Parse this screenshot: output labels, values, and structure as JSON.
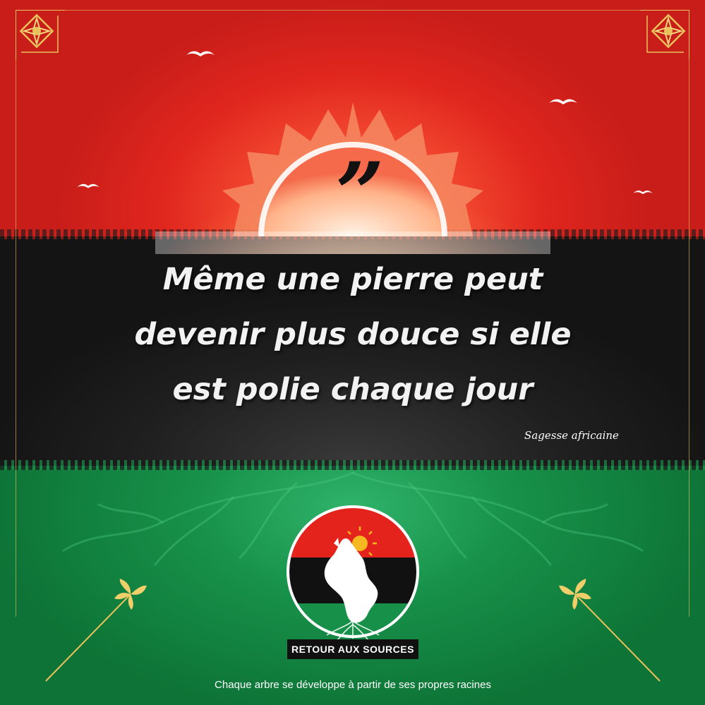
{
  "quote": {
    "mark": "”",
    "lines": [
      "Même une pierre peut",
      "devenir plus douce si elle",
      "est polie chaque jour"
    ]
  },
  "source": "Sagesse africaine",
  "logo": {
    "label": "RETOUR AUX SOURCES"
  },
  "tagline": "Chaque arbre se développe à partir de ses propres racines",
  "colors": {
    "red": "#e0261e",
    "black": "#1c1c1c",
    "green": "#179049",
    "gold": "#e8c25a",
    "white": "#ffffff"
  },
  "icons": [
    "ornament-icon",
    "sun-icon",
    "bird-icon",
    "leaf-sprig-icon",
    "tree-roots-icon",
    "africa-map-icon"
  ]
}
